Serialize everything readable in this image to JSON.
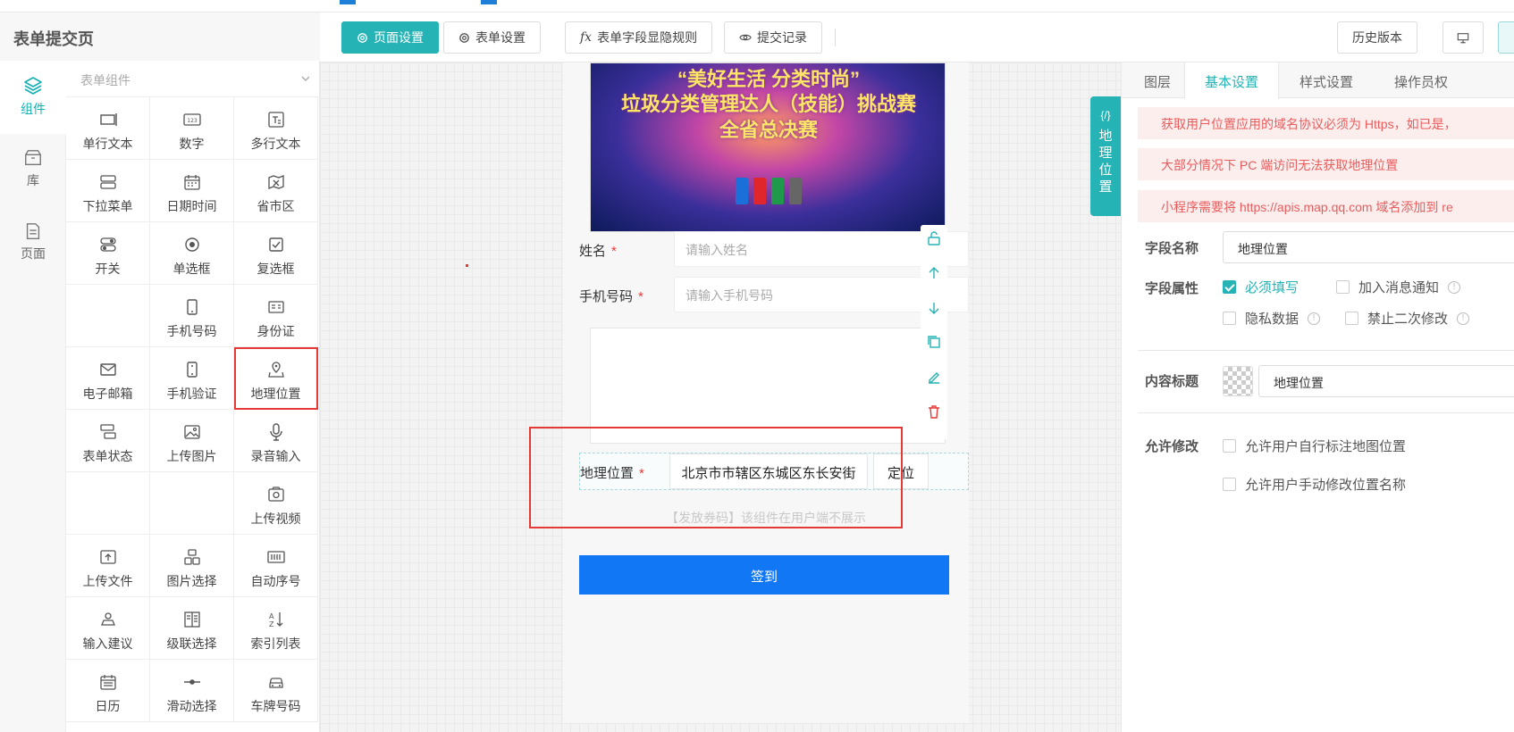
{
  "app": {
    "title": "表单提交页"
  },
  "rail": [
    {
      "label": "组件",
      "icon": "layers-icon",
      "active": true
    },
    {
      "label": "库",
      "icon": "box-icon",
      "active": false
    },
    {
      "label": "页面",
      "icon": "page-icon",
      "active": false
    }
  ],
  "components": {
    "group_label": "表单组件",
    "items": [
      {
        "label": "单行文本",
        "icon": "single-line-text-icon"
      },
      {
        "label": "数字",
        "icon": "number-icon"
      },
      {
        "label": "多行文本",
        "icon": "multi-line-text-icon"
      },
      {
        "label": "下拉菜单",
        "icon": "dropdown-icon"
      },
      {
        "label": "日期时间",
        "icon": "calendar-icon"
      },
      {
        "label": "省市区",
        "icon": "map-region-icon"
      },
      {
        "label": "开关",
        "icon": "toggle-icon"
      },
      {
        "label": "单选框",
        "icon": "radio-icon"
      },
      {
        "label": "复选框",
        "icon": "checkbox-icon"
      },
      {
        "label": "",
        "icon": ""
      },
      {
        "label": "手机号码",
        "icon": "mobile-icon"
      },
      {
        "label": "身份证",
        "icon": "id-card-icon"
      },
      {
        "label": "电子邮箱",
        "icon": "mail-icon"
      },
      {
        "label": "手机验证",
        "icon": "mobile-verify-icon"
      },
      {
        "label": "地理位置",
        "icon": "location-icon"
      },
      {
        "label": "表单状态",
        "icon": "form-status-icon"
      },
      {
        "label": "上传图片",
        "icon": "image-upload-icon"
      },
      {
        "label": "录音输入",
        "icon": "microphone-icon"
      },
      {
        "label": "",
        "icon": ""
      },
      {
        "label": "",
        "icon": ""
      },
      {
        "label": "上传视频",
        "icon": "video-upload-icon"
      },
      {
        "label": "上传文件",
        "icon": "file-upload-icon"
      },
      {
        "label": "图片选择",
        "icon": "image-select-icon"
      },
      {
        "label": "自动序号",
        "icon": "auto-number-icon"
      },
      {
        "label": "输入建议",
        "icon": "input-suggest-icon"
      },
      {
        "label": "级联选择",
        "icon": "cascade-icon"
      },
      {
        "label": "索引列表",
        "icon": "sort-az-icon"
      },
      {
        "label": "日历",
        "icon": "calendar-small-icon"
      },
      {
        "label": "滑动选择",
        "icon": "slider-icon"
      },
      {
        "label": "车牌号码",
        "icon": "car-icon"
      }
    ]
  },
  "toolbar": {
    "page_settings": "页面设置",
    "form_settings": "表单设置",
    "field_rules": "表单字段显隐规则",
    "field_rules_prefix": "fx",
    "submit_records": "提交记录",
    "history": "历史版本"
  },
  "canvas": {
    "banner": {
      "line1": "“美好生活 分类时尚”",
      "line2": "垃圾分类管理达人（技能）挑战赛",
      "line3": "全省总决赛"
    },
    "fields": [
      {
        "label": "姓名",
        "placeholder": "请输入姓名",
        "required": true
      },
      {
        "label": "手机号码",
        "placeholder": "请输入手机号码",
        "required": true
      }
    ],
    "location": {
      "label": "地理位置",
      "value": "北京市市辖区东城区东长安街",
      "button": "定位",
      "required": true
    },
    "hint": "【发放券码】该组件在用户端不展示",
    "submit": "签到",
    "required_mark": "*"
  },
  "geo_tab": {
    "icon_text": "{/}",
    "label": "地理位置"
  },
  "right_panel": {
    "tabs": [
      "图层",
      "基本设置",
      "样式设置",
      "操作员权"
    ],
    "active_tab": "基本设置",
    "alerts": [
      "获取用户位置应用的域名协议必须为 Https，如已是，",
      "大部分情况下 PC 端访问无法获取地理位置",
      "小程序需要将 https://apis.map.qq.com 域名添加到 re"
    ],
    "field_name_label": "字段名称",
    "field_name_value": "地理位置",
    "field_attr_label": "字段属性",
    "attrs": [
      {
        "label": "必须填写",
        "checked": true
      },
      {
        "label": "加入消息通知",
        "checked": false
      },
      {
        "label": "隐私数据",
        "checked": false
      },
      {
        "label": "禁止二次修改",
        "checked": false
      }
    ],
    "content_title_label": "内容标题",
    "content_title_value": "地理位置",
    "allow_edit_label": "允许修改",
    "allow_options": [
      {
        "label": "允许用户自行标注地图位置",
        "checked": false
      },
      {
        "label": "允许用户手动修改位置名称",
        "checked": false
      }
    ]
  },
  "colors": {
    "accent": "#25b3b5",
    "primary_button": "#1177f5",
    "highlight": "#e53935",
    "alert_bg": "#fdeeee",
    "alert_text": "#e85c5c"
  }
}
